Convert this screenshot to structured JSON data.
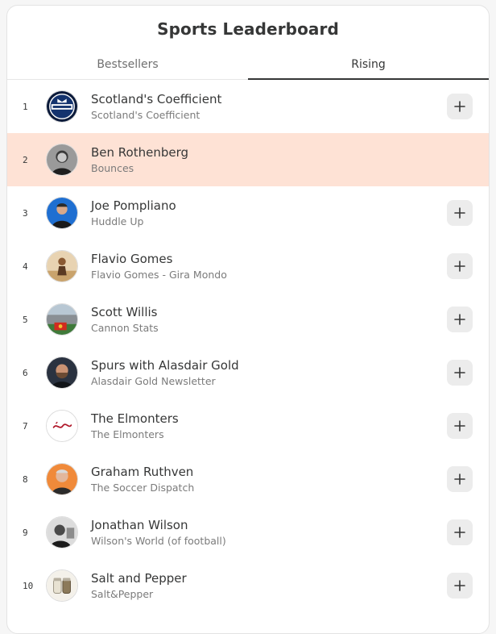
{
  "header": {
    "title": "Sports Leaderboard"
  },
  "tabs": [
    {
      "label": "Bestsellers",
      "active": false
    },
    {
      "label": "Rising",
      "active": true
    }
  ],
  "colors": {
    "highlight": "#fee2d5",
    "text": "#363737",
    "muted": "#7b7b7b",
    "button_bg": "#ececec"
  },
  "entries": [
    {
      "rank": "1",
      "name": "Scotland's Coefficient",
      "subtitle": "Scotland's Coefficient",
      "avatar": "scotland-badge-icon",
      "highlighted": false,
      "add_button": true
    },
    {
      "rank": "2",
      "name": "Ben Rothenberg",
      "subtitle": "Bounces",
      "avatar": "portrait-bw-icon",
      "highlighted": true,
      "add_button": false
    },
    {
      "rank": "3",
      "name": "Joe Pompliano",
      "subtitle": "Huddle Up",
      "avatar": "portrait-blue-icon",
      "highlighted": false,
      "add_button": true
    },
    {
      "rank": "4",
      "name": "Flavio Gomes",
      "subtitle": "Flavio Gomes - Gira Mondo",
      "avatar": "portrait-sepia-icon",
      "highlighted": false,
      "add_button": true
    },
    {
      "rank": "5",
      "name": "Scott Willis",
      "subtitle": "Cannon Stats",
      "avatar": "stadium-icon",
      "highlighted": false,
      "add_button": true
    },
    {
      "rank": "6",
      "name": "Spurs with Alasdair Gold",
      "subtitle": "Alasdair Gold Newsletter",
      "avatar": "portrait-dark-icon",
      "highlighted": false,
      "add_button": true
    },
    {
      "rank": "7",
      "name": "The Elmonters",
      "subtitle": "The Elmonters",
      "avatar": "elmonters-logo-icon",
      "highlighted": false,
      "add_button": true
    },
    {
      "rank": "8",
      "name": "Graham Ruthven",
      "subtitle": "The Soccer Dispatch",
      "avatar": "portrait-orange-icon",
      "highlighted": false,
      "add_button": true
    },
    {
      "rank": "9",
      "name": "Jonathan Wilson",
      "subtitle": "Wilson's World (of football)",
      "avatar": "portrait-bw-wide-icon",
      "highlighted": false,
      "add_button": true
    },
    {
      "rank": "10",
      "name": "Salt and Pepper",
      "subtitle": "Salt&Pepper",
      "avatar": "salt-pepper-icon",
      "highlighted": false,
      "add_button": true
    }
  ]
}
